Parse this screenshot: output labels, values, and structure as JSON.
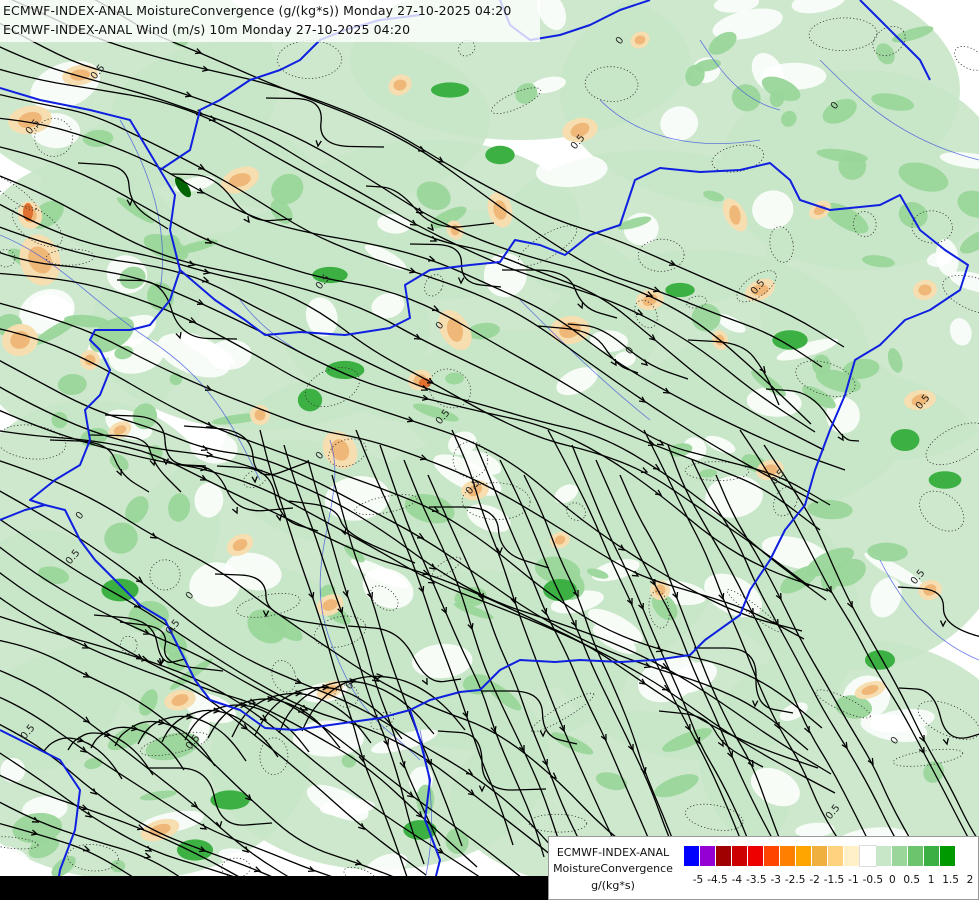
{
  "header": {
    "line1": "ECMWF-INDEX-ANAL MoistureConvergence (g/(kg*s)) Monday 27-10-2025 04:20",
    "line2": "ECMWF-INDEX-ANAL Wind (m/s) 10m Monday 27-10-2025 04:20"
  },
  "legend": {
    "title_line1": "ECMWF-INDEX-ANAL",
    "title_line2": "MoistureConvergence",
    "unit": "g/(kg*s)",
    "colors": [
      "#0000ff",
      "#9400d3",
      "#a00000",
      "#cc0000",
      "#ee0000",
      "#ff4500",
      "#ff7f00",
      "#ffa500",
      "#f0b040",
      "#ffd27f",
      "#fff0c8",
      "#ffffff",
      "#c8e6c8",
      "#9ad69a",
      "#6cc46c",
      "#3cb043",
      "#009900"
    ],
    "tick_labels": [
      "-5",
      "-4.5",
      "-4",
      "-3.5",
      "-3",
      "-2.5",
      "-2",
      "-1.5",
      "-1",
      "-0.5",
      "0",
      "0.5",
      "1",
      "1.5",
      "2"
    ]
  },
  "map": {
    "contour_labels": [
      "0",
      "0.5",
      "0.5",
      "0",
      "0.5",
      "0.5",
      "0",
      "0.5",
      "0",
      "0.5",
      "0.5",
      "0",
      "0.5",
      "0.5",
      "0",
      "0.5",
      "0.5",
      "0",
      "0.5",
      "0",
      "0.5",
      "0.5",
      "0",
      "0.5"
    ],
    "colors": {
      "background": "#ffffff",
      "convergence_light": "#c8e6c8",
      "convergence_mid": "#9ad69a",
      "convergence_strong": "#3cb043",
      "convergence_max": "#006400",
      "divergence_light": "#f7deb0",
      "divergence_mid": "#f0b878",
      "divergence_strong": "#e07030",
      "border": "#1020e0",
      "river": "#3a4fe0",
      "streamline": "#000000"
    }
  }
}
